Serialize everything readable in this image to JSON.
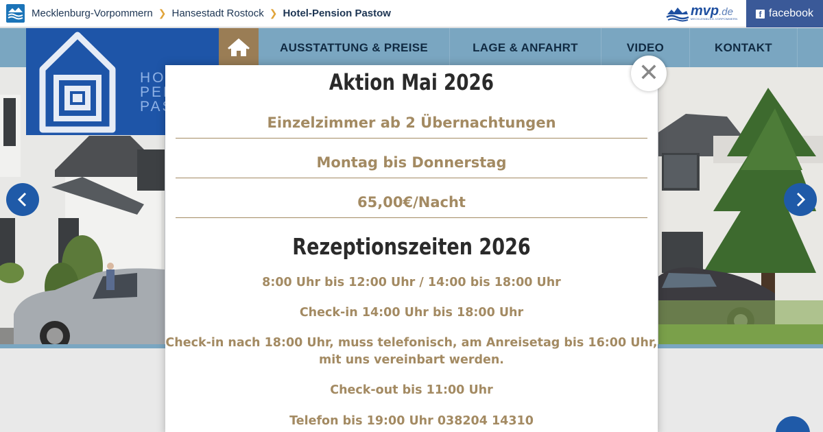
{
  "topbar": {
    "breadcrumbs": [
      "Mecklenburg-Vorpommern",
      "Hansestadt Rostock",
      "Hotel-Pension Pastow"
    ],
    "mvp_logo_text": "mvp",
    "mvp_logo_tld": ".de",
    "mvp_logo_subtitle": "MECKLENBURG-VORPOMMERN",
    "facebook_label": "facebook"
  },
  "nav": {
    "items": [
      "AUSSTATTUNG & PREISE",
      "LAGE & ANFAHRT",
      "VIDEO",
      "KONTAKT"
    ]
  },
  "logo": {
    "lines": [
      "HO",
      "PEN",
      "PAS"
    ]
  },
  "modal": {
    "title": "Aktion Mai 2026",
    "offer_lines": [
      "Einzelzimmer ab 2 Übernachtungen",
      "Montag bis Donnerstag",
      "65,00€/Nacht"
    ],
    "section_title": "Rezeptionszeiten 2026",
    "info_lines": [
      "8:00 Uhr bis 12:00 Uhr / 14:00 bis 18:00 Uhr",
      "Check-in 14:00 Uhr bis 18:00 Uhr",
      "Check-in nach 18:00 Uhr, muss telefonisch, am Anreisetag bis 16:00 Uhr,",
      "mit uns vereinbart werden.",
      "Check-out bis 11:00 Uhr",
      "Telefon bis 19:00 Uhr 038204 14310"
    ],
    "close_symbol": "✕"
  },
  "colors": {
    "nav_bg": "#7aa6c1",
    "accent_gold": "#a38a62",
    "brand_blue": "#1e55a8",
    "facebook_blue": "#3a5998"
  }
}
